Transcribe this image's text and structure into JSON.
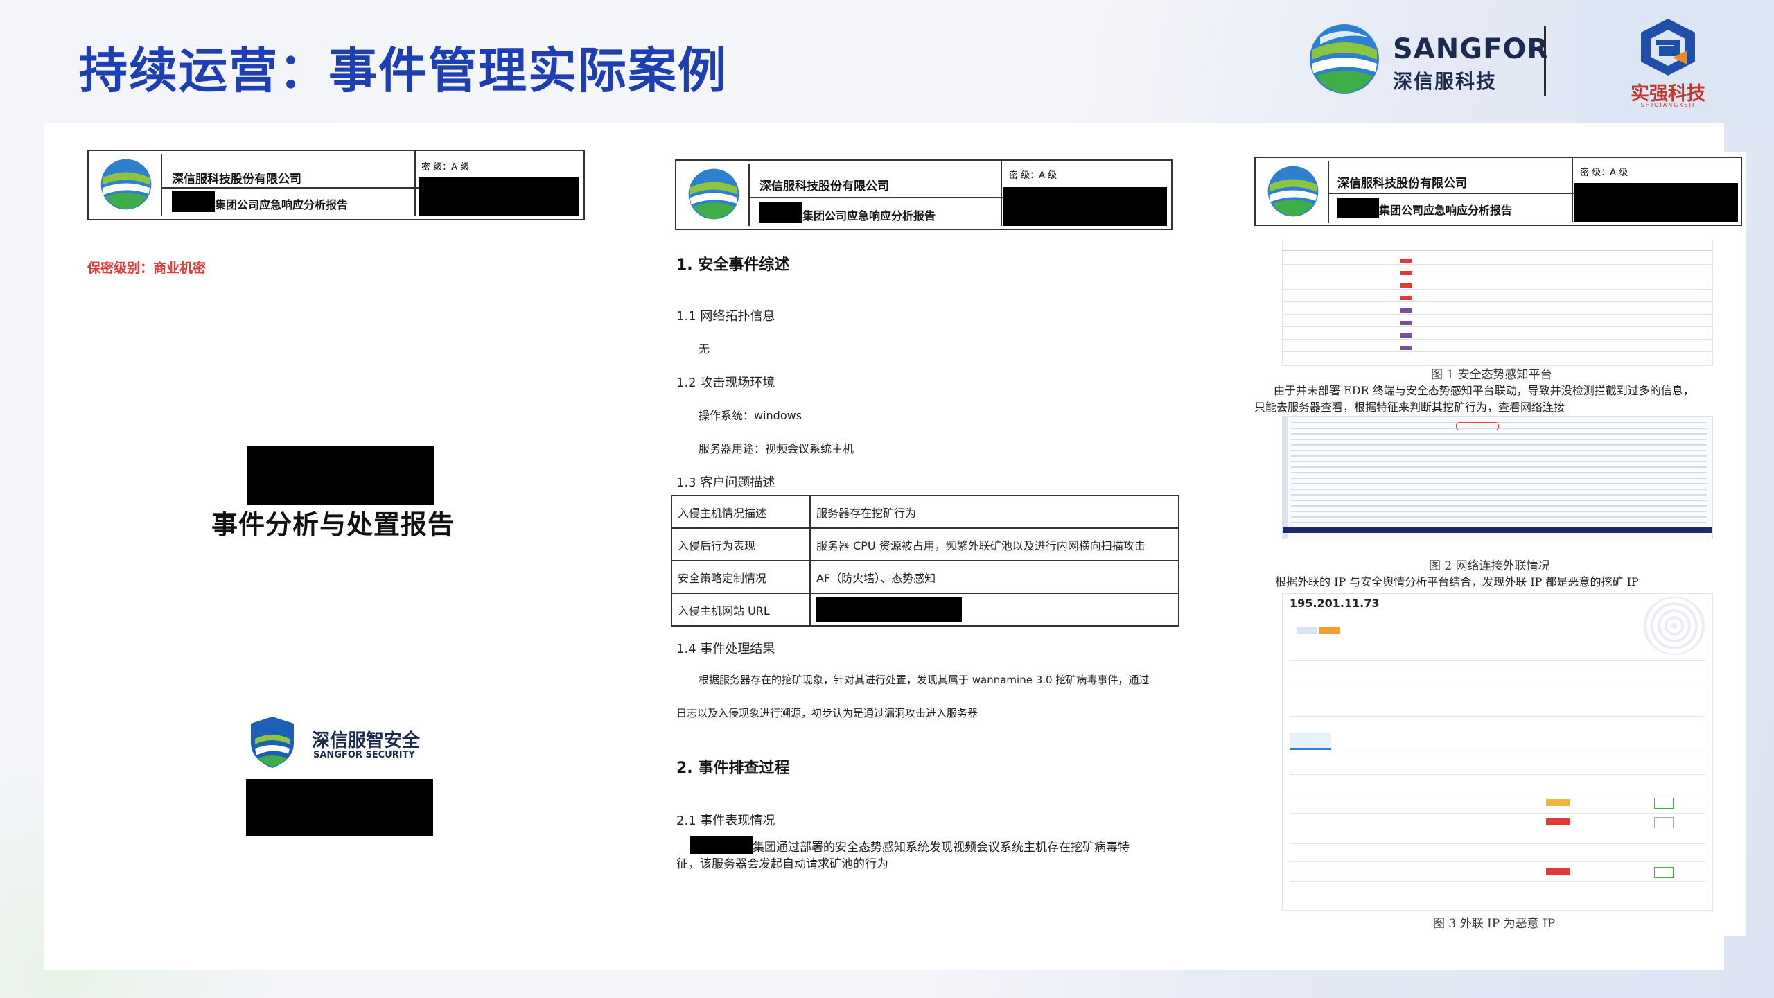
{
  "slide": {
    "title": "持续运营：事件管理实际案例"
  },
  "brand": {
    "name_en": "SANGFOR",
    "name_cn": "深信服科技",
    "partner_name": "实强科技",
    "partner_sub": "SHIQIANGKEJI"
  },
  "colors": {
    "title_blue": "#1d3fb3",
    "secret_red": "#e53935",
    "sangfor_green": "#3fae49",
    "sangfor_blue": "#1c5fb6",
    "partner_blue": "#1f4fa8",
    "partner_orange": "#f08a1c"
  },
  "doc_header": {
    "company": "深信服科技股份有限公司",
    "report": "集团公司应急响应分析报告",
    "secret_level": "密      级：A 级"
  },
  "doc1": {
    "confidential": "保密级别：商业机密",
    "report_title": "事件分析与处置报告",
    "security_cn": "深信服智安全",
    "security_en": "SANGFOR SECURITY"
  },
  "doc2": {
    "s1": "1. 安全事件综述",
    "s1_1": "1.1 网络拓扑信息",
    "s1_1_body": "无",
    "s1_2": "1.2 攻击现场环境",
    "os": "操作系统：windows",
    "usage": "服务器用途：视频会议系统主机",
    "s1_3": "1.3 客户问题描述",
    "table": [
      {
        "k": "入侵主机情况描述",
        "v": "服务器存在挖矿行为"
      },
      {
        "k": "入侵后行为表现",
        "v": "服务器 CPU 资源被占用，频繁外联矿池以及进行内网横向扫描攻击"
      },
      {
        "k": "安全策略定制情况",
        "v": "AF（防火墙）、态势感知"
      },
      {
        "k": "入侵主机网站 URL",
        "v": ""
      }
    ],
    "s1_4": "1.4 事件处理结果",
    "result_line1": "根据服务器存在的挖矿现象，针对其进行处置，发现其属于 wannamine 3.0 挖矿病毒事件，通过",
    "result_line2": "日志以及入侵现象进行溯源，初步认为是通过漏洞攻击进入服务器",
    "s2": "2. 事件排查过程",
    "s2_1": "2.1 事件表现情况",
    "s2_1_line1": "集团通过部署的安全态势感知系统发现视频会议系统主机存在挖矿病毒特",
    "s2_1_line2": "征，该服务器会发起自动请求矿池的行为"
  },
  "doc3": {
    "fig1_caption": "图 1  安全态势感知平台",
    "para1_line1": "由于并未部署 EDR 终端与安全态势感知平台联动，导致并没检测拦截到过多的信息，",
    "para1_line2": "只能去服务器查看，根据特征来判断其挖矿行为，查看网络连接",
    "fig2_caption": "图 2  网络连接外联情况",
    "para2": "根据外联的 IP 与安全舆情分析平台结合，发现外联 IP 都是恶意的挖矿 IP",
    "ip": "195.201.11.73",
    "fig3_caption": "图 3  外联 IP 为恶意 IP"
  }
}
